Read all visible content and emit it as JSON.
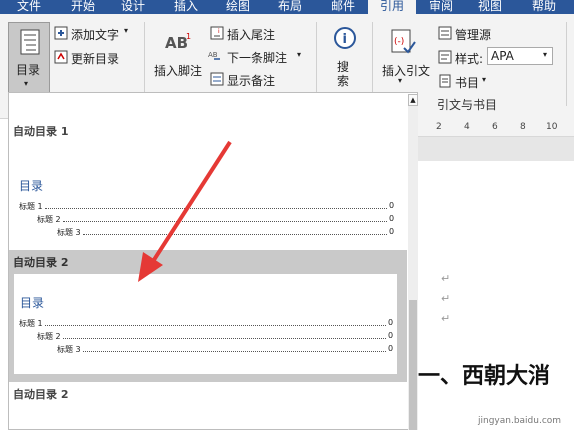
{
  "tabs": [
    "文件",
    "开始",
    "设计",
    "插入",
    "绘图",
    "布局",
    "邮件",
    "引用",
    "审阅",
    "视图",
    "帮助"
  ],
  "ribbon": {
    "toc_label": "目录",
    "add_text": "添加文字",
    "update_toc": "更新目录",
    "insert_footnote": "插入脚注",
    "insert_endnote": "插入尾注",
    "next_footnote": "下一条脚注",
    "show_notes": "显示备注",
    "search": "搜索",
    "insert_citation": "插入引文",
    "manage_sources": "管理源",
    "style_label": "样式:",
    "style_value": "APA",
    "bibliography": "书目",
    "group_citations": "引文与书目",
    "ab_label": "AB"
  },
  "ruler": [
    "2",
    "4",
    "6",
    "8",
    "10"
  ],
  "gallery": {
    "auto_toc_1": "自动目录 1",
    "auto_toc_2": "自动目录 2",
    "auto_toc_2b": "自动目录 2",
    "toc_heading": "目录",
    "entries": [
      {
        "label": "标题 1",
        "page": "0"
      },
      {
        "label": "标题 2",
        "page": "0"
      },
      {
        "label": "标题 3",
        "page": "0"
      }
    ]
  },
  "doc": {
    "heading": "一、西朝大消",
    "watermark": "jingyan.baidu.com"
  },
  "colors": {
    "brand": "#2b579a",
    "arrow": "#e53935"
  }
}
